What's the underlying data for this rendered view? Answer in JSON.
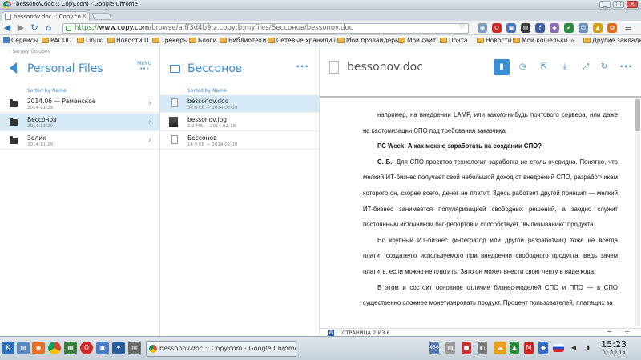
{
  "window": {
    "title": "bessonov.doc :: Copy.com - Google Chrome"
  },
  "tab": {
    "label": "bessonov.doc :: Copy.co"
  },
  "address": {
    "proto": "https://",
    "domain": "www.copy.com",
    "path": "/browse/a:ff3d4b9;z:copy;b:myfiles/Бессонов/bessonov.doc"
  },
  "bookmarks": [
    "Сервисы",
    "РАСПО",
    "Linux",
    "Новости IT",
    "Трекеры",
    "Блоги",
    "Библиотеки",
    "Сетевые хранилищ",
    "Мои провайдеры",
    "Мой сайт",
    "Почта",
    "Новости",
    "Мои кошельки",
    "Другие закладки"
  ],
  "user": "Sergey Golubev",
  "pane1": {
    "title": "Personal Files",
    "menu": "MENU",
    "sorted": "Sorted by Name",
    "items": [
      {
        "name": "2014.06 — Раменское",
        "meta": "2014-11-29"
      },
      {
        "name": "Бессонов",
        "meta": "2014-11-29"
      },
      {
        "name": "Зелик",
        "meta": "2014-11-29"
      }
    ]
  },
  "pane2": {
    "title": "Бессонов",
    "sorted": "Sorted by Name",
    "items": [
      {
        "name": "bessonov.doc",
        "meta": "32.0 KB — 2014-02-19"
      },
      {
        "name": "bessonov.jpg",
        "meta": "1.2 MB — 2014-02-18"
      },
      {
        "name": "Бессонов",
        "meta": "14.9 KB — 2014-02-18"
      }
    ]
  },
  "pane3": {
    "title": "bessonov.doc"
  },
  "doc": {
    "p1": "например, на внедрении LAMP, или какого-нибудь почтового сервера, или даже на кастомизации СПО под требования заказчика.",
    "q1": "PC Week: А как можно заработать на создании СПО?",
    "p2b": "С. Б.:",
    "p2": " Для СПО-проектов технология заработка не столь очевидна. Понятно, что мелкий ИТ-бизнес получает свой небольшой доход от внедрений СПО, разработчикам которого он, скорее всего, денег не платит. Здесь работает другой принцип — мелкий ИТ-бизнес занимается популяризацией свободных решений, а заодно служит постоянным источником баг-репортов и способствует \"вылизыванию\" продукта.",
    "p3": "Но крупный ИТ-бизнес (интегратор или другой разработчик) тоже не всегда платит создателю используемого при внедрении свободного продукта, ведь зачем платить, если можно не платить. Зато он может внести свою лепту в виде кода.",
    "p4": "В этом и состоит основное отличие бизнес-моделей СПО и ППО — в СПО существенно сложнее монетизировать продукт. Процент пользователей, платящих за",
    "page": "СТРАНИЦА 2 ИЗ 6"
  },
  "taskbar": {
    "task": "bessonov.doc :: Copy.com - Google Chrome",
    "time": "15:23",
    "date": "01.12.14"
  }
}
